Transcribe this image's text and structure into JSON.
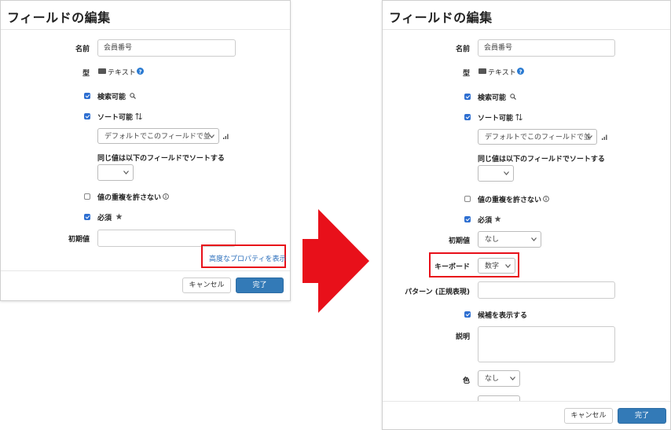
{
  "dialog_title": "フィールドの編集",
  "labels": {
    "name": "名前",
    "type": "型",
    "searchable": "検索可能",
    "sortable": "ソート可能",
    "same_value_sort": "同じ値は以下のフィールドでソートする",
    "unique": "値の重複を許さない",
    "required": "必須",
    "initial_value": "初期値",
    "keyboard": "キーボード",
    "pattern": "パターン (正規表現)",
    "show_candidates": "候補を表示する",
    "description": "説明",
    "color": "色"
  },
  "values": {
    "name": "会員番号",
    "type": "テキスト",
    "sort_default": "デフォルトでこのフィールドで並",
    "initial_value_right": "なし",
    "keyboard": "数字",
    "color": "なし"
  },
  "checkboxes": {
    "searchable": true,
    "sortable": true,
    "unique": false,
    "required": true,
    "show_candidates": true
  },
  "advanced_link": "高度なプロパティを表示",
  "buttons": {
    "cancel": "キャンセル",
    "done": "完了"
  },
  "colors": {
    "accent": "#337ab7",
    "highlight": "#e8101a",
    "checkbox": "#2e6fd1",
    "link": "#2a6ebb",
    "help_icon": "#2a7ad1"
  },
  "icons": {
    "type": "text-field-icon",
    "help": "question-circle-icon",
    "searchable": "search-icon",
    "sortable": "sort-arrows-icon",
    "sort_order": "bar-chart-icon",
    "unique": "info-circle-icon",
    "required": "star-icon",
    "select": "chevron-down-icon",
    "transition": "right-arrow-icon"
  }
}
